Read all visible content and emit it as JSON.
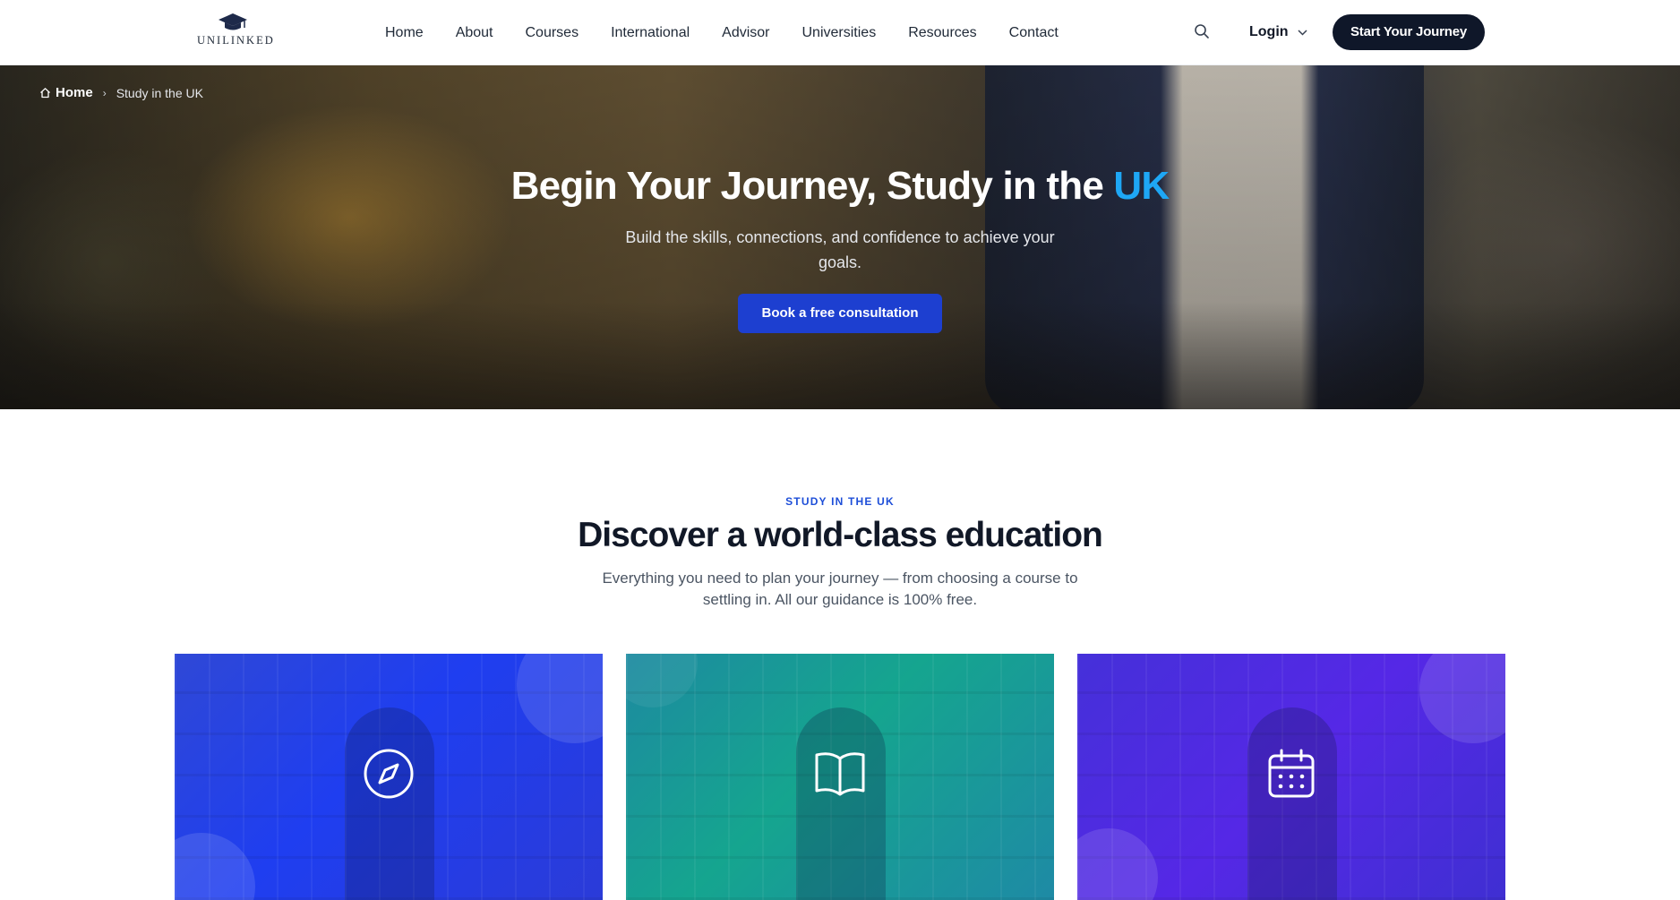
{
  "header": {
    "logo_text": "UNILINKED",
    "nav": [
      "Home",
      "About",
      "Courses",
      "International",
      "Advisor",
      "Universities",
      "Resources",
      "Contact"
    ],
    "search_icon": "search-icon",
    "login_label": "Login",
    "cta_label": "Start Your Journey"
  },
  "hero": {
    "breadcrumb": {
      "home": "Home",
      "current": "Study in the UK"
    },
    "title_main": "Begin Your Journey, Study in the ",
    "title_accent": "UK",
    "subtitle": "Build the skills, connections, and confidence to achieve your goals.",
    "button_label": "Book a free consultation"
  },
  "section": {
    "eyebrow": "STUDY IN THE UK",
    "title": "Discover a world-class education",
    "description": "Everything you need to plan your journey — from choosing a course to settling in. All our guidance is 100% free."
  },
  "cards": [
    {
      "icon": "compass-icon"
    },
    {
      "icon": "open-book-icon"
    },
    {
      "icon": "calendar-icon"
    }
  ],
  "colors": {
    "primary_dark": "#0f1729",
    "accent_blue": "#1ea7f5",
    "button_blue": "#1d3fd0",
    "eyebrow_blue": "#1d4ed8"
  }
}
